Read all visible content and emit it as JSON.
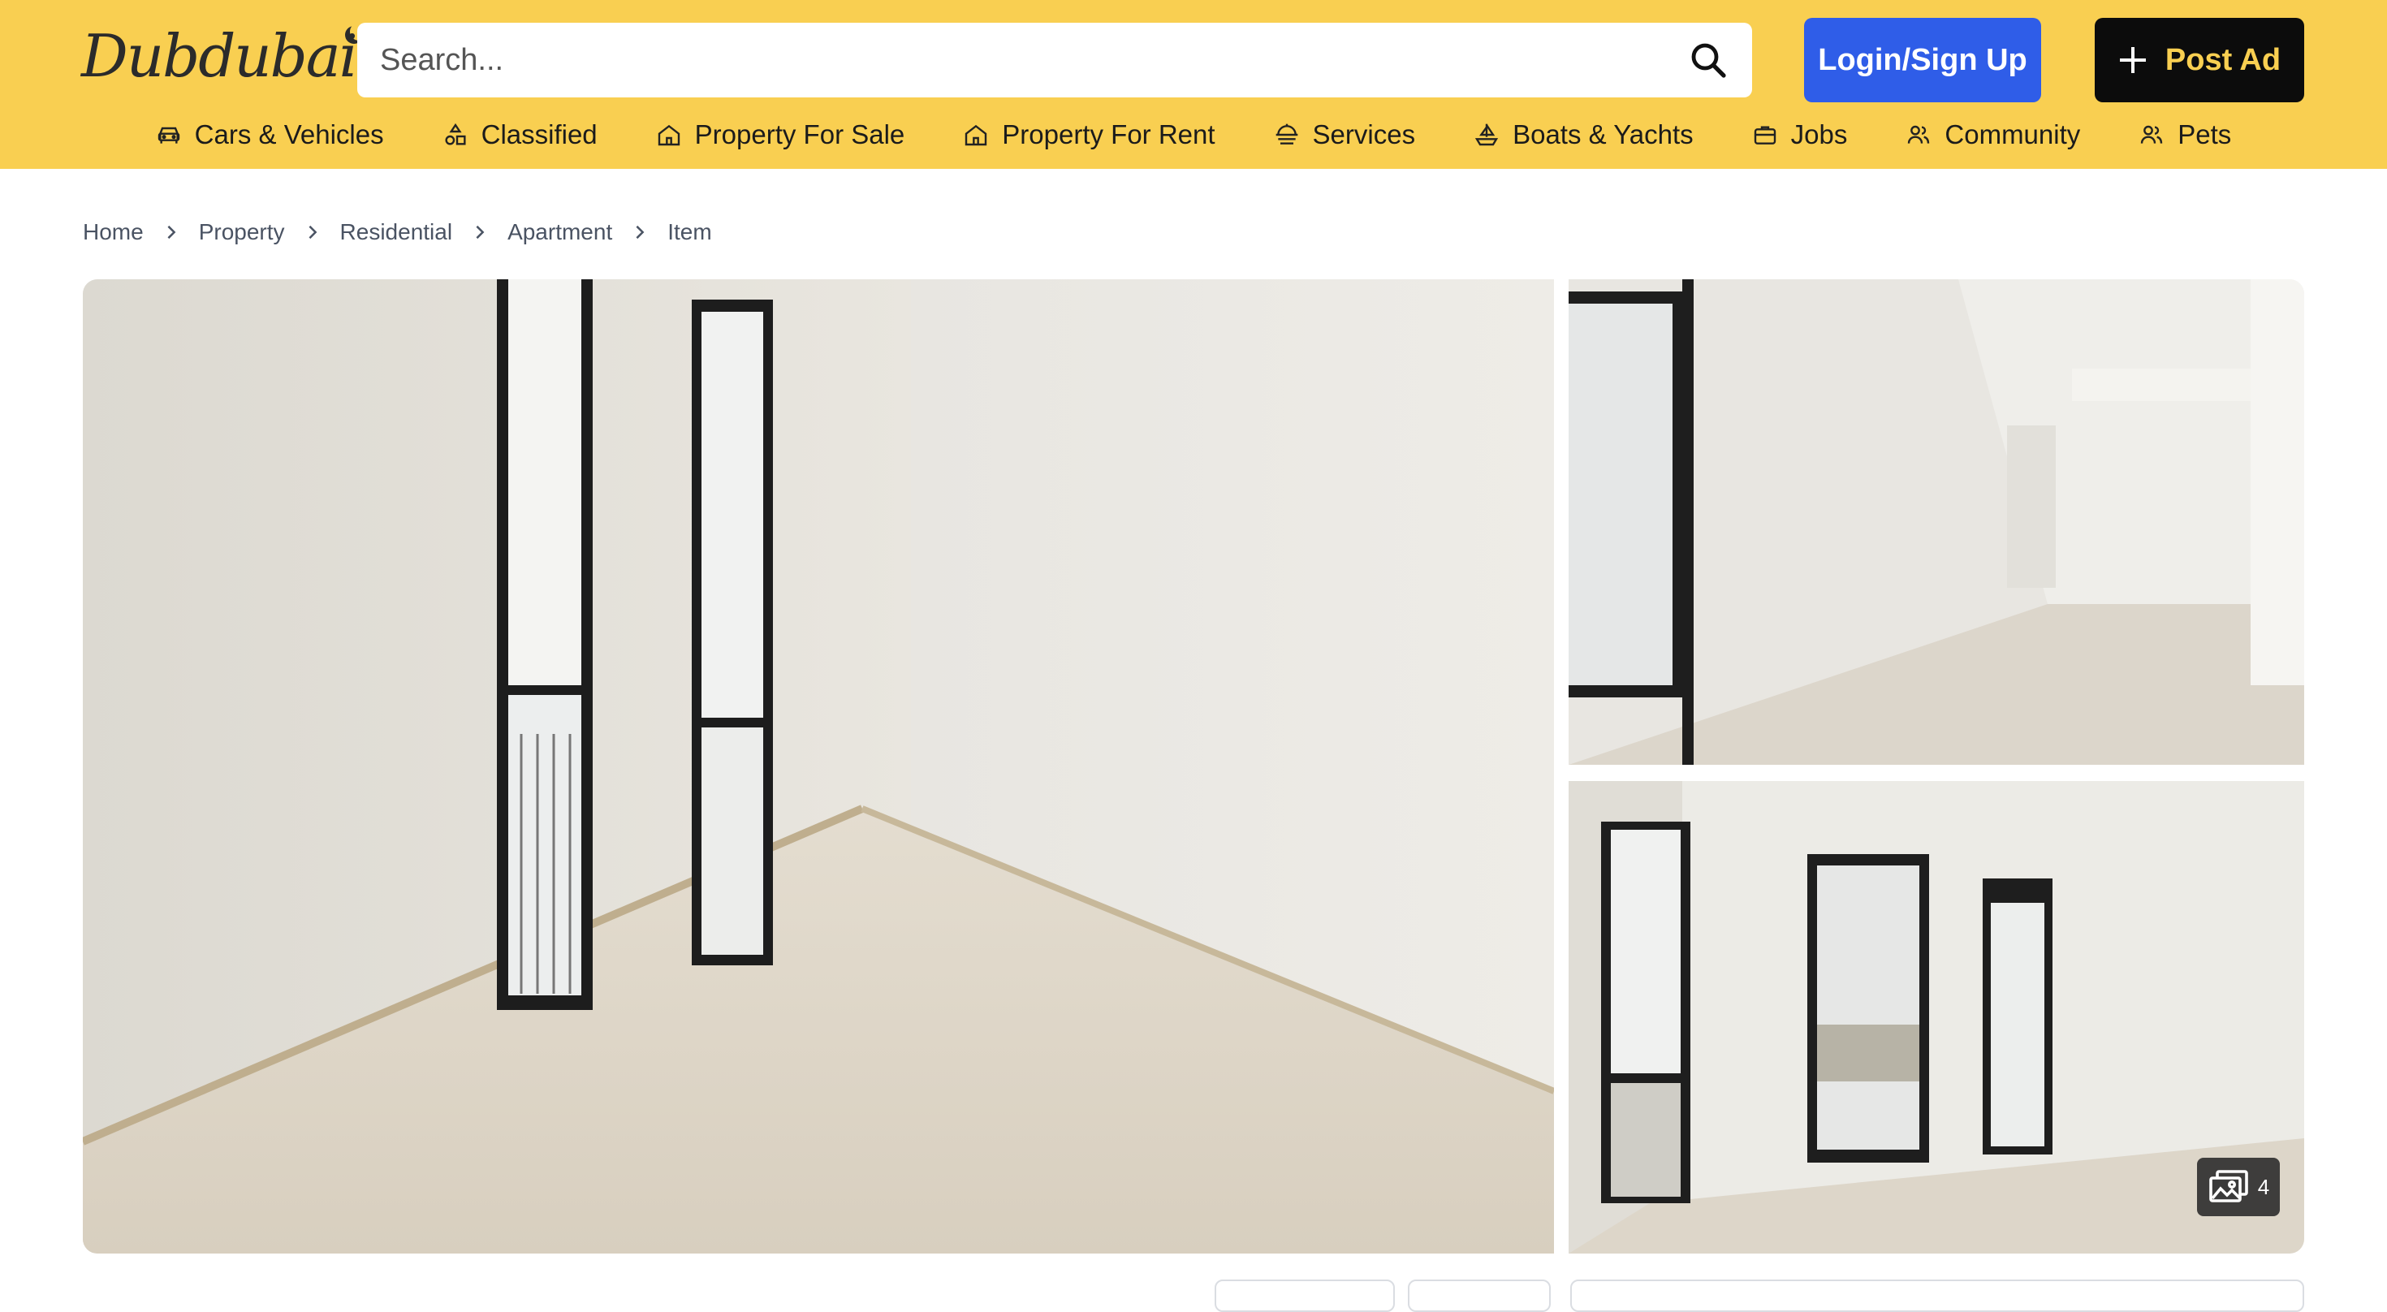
{
  "header": {
    "logo_text": "Dubdubai",
    "search_placeholder": "Search...",
    "login_label": "Login/Sign Up",
    "post_ad_label": "Post Ad",
    "brand_color": "#f9cf51",
    "login_color": "#2f5de8"
  },
  "nav": {
    "items": [
      {
        "label": "Cars & Vehicles",
        "icon": "car-icon"
      },
      {
        "label": "Classified",
        "icon": "shapes-icon"
      },
      {
        "label": "Property For Sale",
        "icon": "home-icon"
      },
      {
        "label": "Property For Rent",
        "icon": "home-icon"
      },
      {
        "label": "Services",
        "icon": "services-icon"
      },
      {
        "label": "Boats & Yachts",
        "icon": "boat-icon"
      },
      {
        "label": "Jobs",
        "icon": "briefcase-icon"
      },
      {
        "label": "Community",
        "icon": "people-icon"
      },
      {
        "label": "Pets",
        "icon": "people-icon"
      }
    ]
  },
  "breadcrumb": {
    "items": [
      "Home",
      "Property",
      "Residential",
      "Apartment",
      "Item"
    ]
  },
  "gallery": {
    "photo_count": "4"
  }
}
